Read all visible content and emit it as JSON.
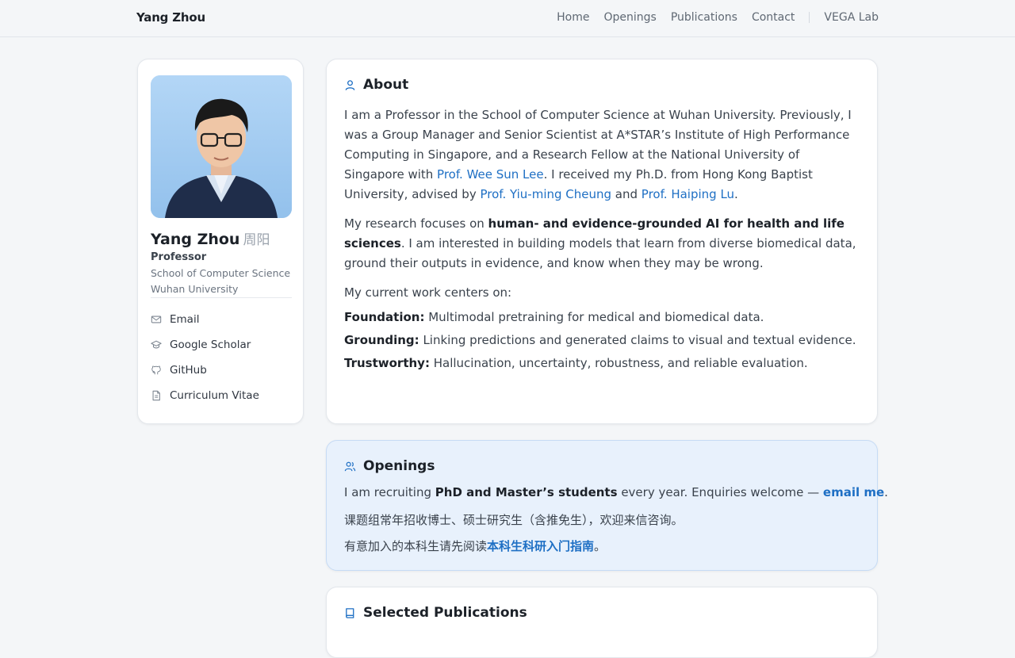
{
  "header": {
    "brand": "Yang Zhou",
    "nav": [
      "Home",
      "Openings",
      "Publications",
      "Contact"
    ],
    "lab": "VEGA Lab"
  },
  "profile": {
    "name": "Yang Zhou",
    "name_cn": "周阳",
    "role": "Professor",
    "dept": "School of Computer Science",
    "uni": "Wuhan University",
    "links": [
      {
        "label": "Email",
        "icon": "mail-icon"
      },
      {
        "label": "Google Scholar",
        "icon": "graduation-cap-icon"
      },
      {
        "label": "GitHub",
        "icon": "github-icon"
      },
      {
        "label": "Curriculum Vitae",
        "icon": "document-icon"
      }
    ]
  },
  "about": {
    "title": "About",
    "p1": {
      "a": "I am a Professor in the School of Computer Science at Wuhan University. Previously, I was a Group Manager and Senior Scientist at A*STAR’s Institute of High Performance Computing in Singapore, and a Research Fellow at the National University of Singapore with ",
      "l1": "Prof. Wee Sun Lee",
      "b": ". I received my Ph.D. from Hong Kong Baptist University, advised by ",
      "l2": "Prof. Yiu-ming Cheung",
      "c": " and ",
      "l3": "Prof. Haiping Lu",
      "d": "."
    },
    "p2": {
      "a": "My research focuses on ",
      "bold": "human- and evidence-grounded AI for health and life sciences",
      "b": ". I am interested in building models that learn from diverse biomedical data, ground their outputs in evidence, and know when they may be wrong."
    },
    "p3": "My current work centers on:",
    "focus": [
      {
        "k": "Foundation:",
        "v": " Multimodal pretraining for medical and biomedical data."
      },
      {
        "k": "Grounding:",
        "v": " Linking predictions and generated claims to visual and textual evidence."
      },
      {
        "k": "Trustworthy:",
        "v": " Hallucination, uncertainty, robustness, and reliable evaluation."
      }
    ]
  },
  "openings": {
    "title": "Openings",
    "l1": {
      "a": "I am recruiting ",
      "bold": "PhD and Master’s students",
      "b": " every year. Enquiries welcome — ",
      "link": "email me",
      "c": "."
    },
    "l2": "课题组常年招收博士、硕士研究生（含推免生），欢迎来信咨询。",
    "l3": {
      "a": "有意加入的本科生请先阅读",
      "link": "本科生科研入门指南",
      "b": "。"
    }
  },
  "publications": {
    "title": "Selected Publications"
  },
  "colors": {
    "accent": "#1e6fc4",
    "openings_bg": "#e8f1fc",
    "page_bg": "#f4f6f8"
  }
}
